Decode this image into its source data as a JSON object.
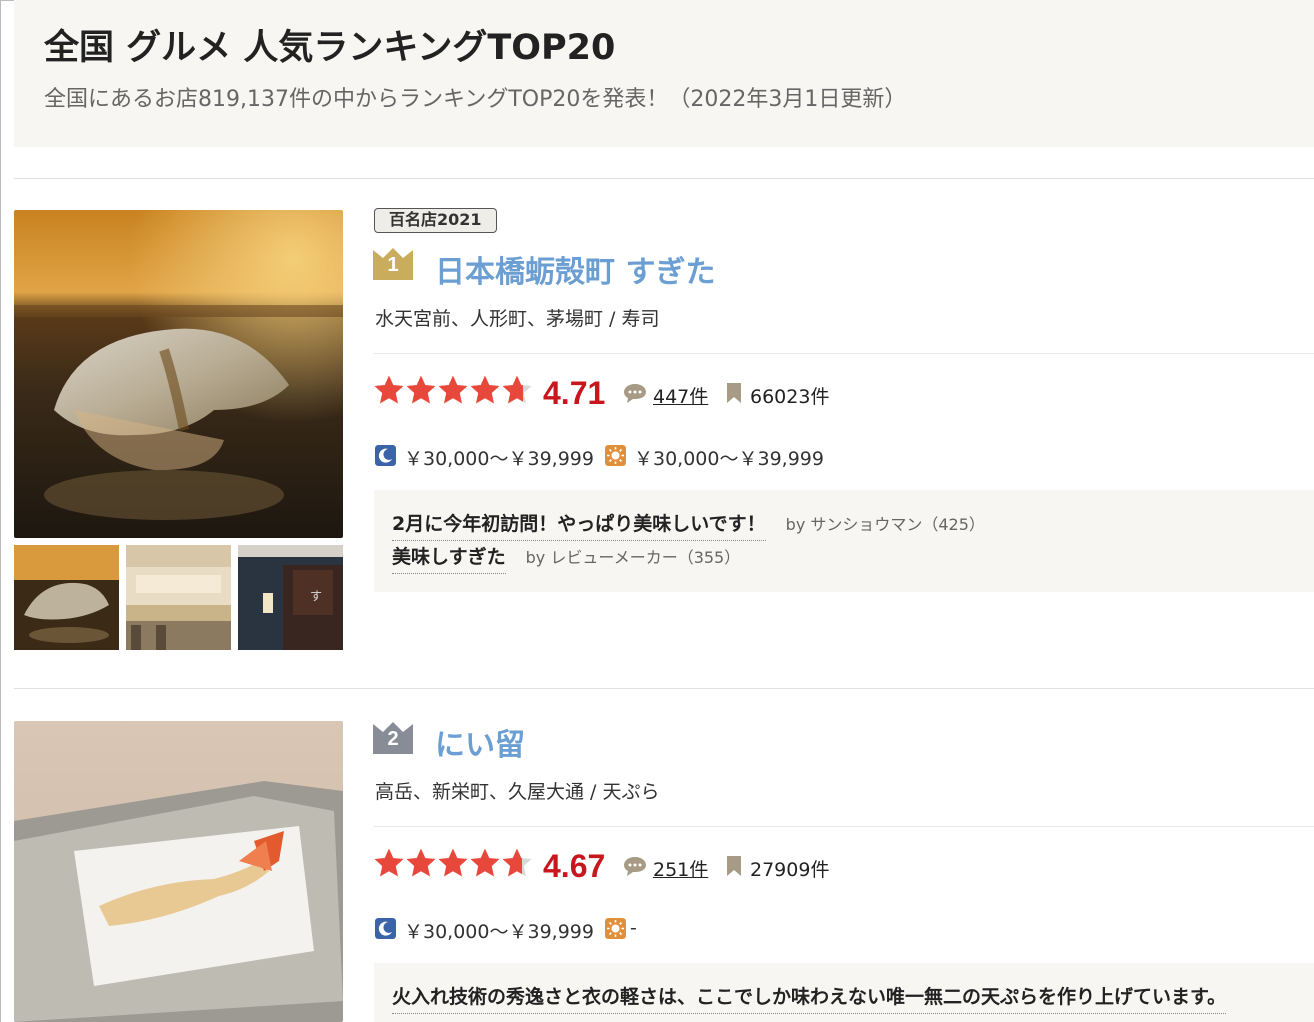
{
  "page": {
    "title": "全国 グルメ 人気ランキングTOP20",
    "subtitle": "全国にあるお店819,137件の中からランキングTOP20を発表！（2022年3月1日更新）"
  },
  "colors": {
    "star": "#e8483b",
    "score": "#c8161d",
    "link": "#6b9fd3",
    "gold": "#c9ad5c",
    "silver": "#888c96"
  },
  "restaurants": [
    {
      "award": "百名店2021",
      "rank": "1",
      "name": "日本橋蛎殻町 すぎた",
      "area": "水天宮前、人形町、茅場町 / 寿司",
      "rating": 4.71,
      "rating_text": "4.71",
      "reviews": "447件",
      "bookmarks": "66023件",
      "dinner_price": "￥30,000～￥39,999",
      "lunch_price": "￥30,000～￥39,999",
      "review_snippets": [
        {
          "title": "2月に今年初訪問！やっぱり美味しいです！",
          "by": "by サンショウマン（425）"
        },
        {
          "title": "美味しすぎた",
          "by": "by レビューメーカー（355）"
        }
      ],
      "icons": {
        "dinner": "moon-icon",
        "lunch": "sun-icon",
        "reviews": "speech-bubble-icon",
        "bookmarks": "bookmark-icon"
      }
    },
    {
      "rank": "2",
      "name": "にい留",
      "area": "高岳、新栄町、久屋大通 / 天ぷら",
      "rating": 4.67,
      "rating_text": "4.67",
      "reviews": "251件",
      "bookmarks": "27909件",
      "dinner_price": "￥30,000～￥39,999",
      "lunch_price": "-",
      "review_snippets": [
        {
          "title": "火入れ技術の秀逸さと衣の軽さは、ここでしか味わえない唯一無二の天ぷらを作り上げています。",
          "by": ""
        }
      ]
    }
  ]
}
